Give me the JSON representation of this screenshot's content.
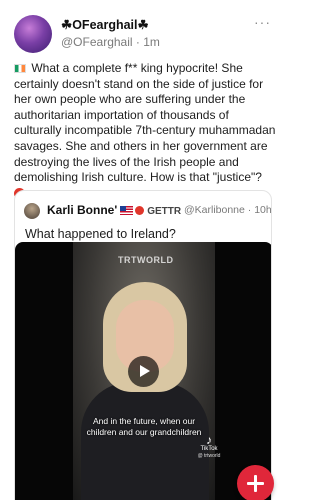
{
  "post": {
    "author_name": "☘OFearghail☘",
    "handle": "@OFearghail",
    "time": "1m",
    "more_label": "···",
    "text": "What a complete f** king hypocrite! She certainly doesn't stand on the side of justice for her own people who are suffering under the authoritarian importation of thousands of culturally incompatible 7th-century muhammadan savages. She and others in her government are destroying the lives of the Irish people and demolishing Irish culture. How is that \"justice\"?",
    "leading_icon": "ireland-flag-icon",
    "trailing_icon": "angry-face-icon"
  },
  "quote": {
    "author_name": "Karli Bonne'",
    "source": "GETTR",
    "handle": "@Karlibonne",
    "time": "10h",
    "text": "What happened to Ireland?",
    "badges": [
      "us-flag-icon",
      "verified-icon"
    ],
    "video": {
      "watermark": "TRTWORLD",
      "caption": "And in the future, when our children and our grandchildren",
      "tiktok_label": "TikTok",
      "tiktok_handle": "@ trtworld"
    }
  },
  "fab": {
    "icon": "plus-icon"
  },
  "colors": {
    "accent": "#e0273a",
    "muted_text": "#7a7a7a",
    "body_text": "#1d1d1d"
  }
}
